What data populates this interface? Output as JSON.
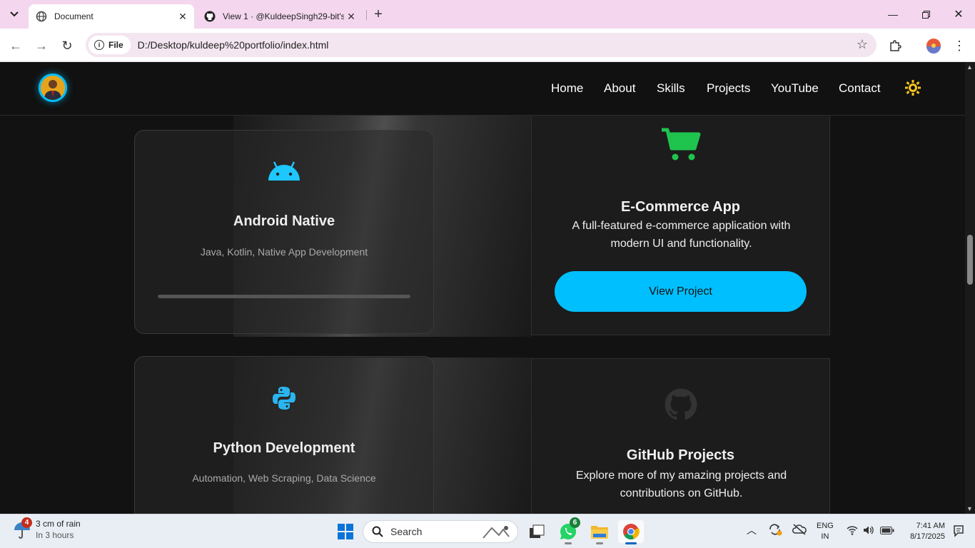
{
  "browser": {
    "tabs": [
      {
        "title": "Document",
        "active": true
      },
      {
        "title": "View 1 · @KuldeepSingh29-bit's",
        "active": false
      }
    ],
    "address": {
      "chip": "File",
      "url": "D:/Desktop/kuldeep%20portfolio/index.html"
    }
  },
  "site": {
    "nav": [
      "Home",
      "About",
      "Skills",
      "Projects",
      "YouTube",
      "Contact"
    ],
    "accent": "#00bfff",
    "skills": [
      {
        "icon": "android-icon",
        "title": "Android Native",
        "desc": "Java, Kotlin, Native App Development",
        "progress_pct": 100
      },
      {
        "icon": "python-icon",
        "title": "Python Development",
        "desc": "Automation, Web Scraping, Data Science"
      }
    ],
    "projects": [
      {
        "icon": "shopping-cart-icon",
        "title": "E-Commerce App",
        "desc": "A full-featured e-commerce application with modern UI and functionality.",
        "button": "View Project"
      },
      {
        "icon": "github-icon",
        "title": "GitHub Projects",
        "desc": "Explore more of my amazing projects and contributions on GitHub."
      }
    ]
  },
  "taskbar": {
    "weather": {
      "badge": "4",
      "line1": "3 cm of rain",
      "line2": "In 3 hours"
    },
    "search_placeholder": "Search",
    "whatsapp_badge": "6",
    "lang": {
      "line1": "ENG",
      "line2": "IN"
    },
    "clock": {
      "time": "7:41 AM",
      "date": "8/17/2025"
    }
  }
}
